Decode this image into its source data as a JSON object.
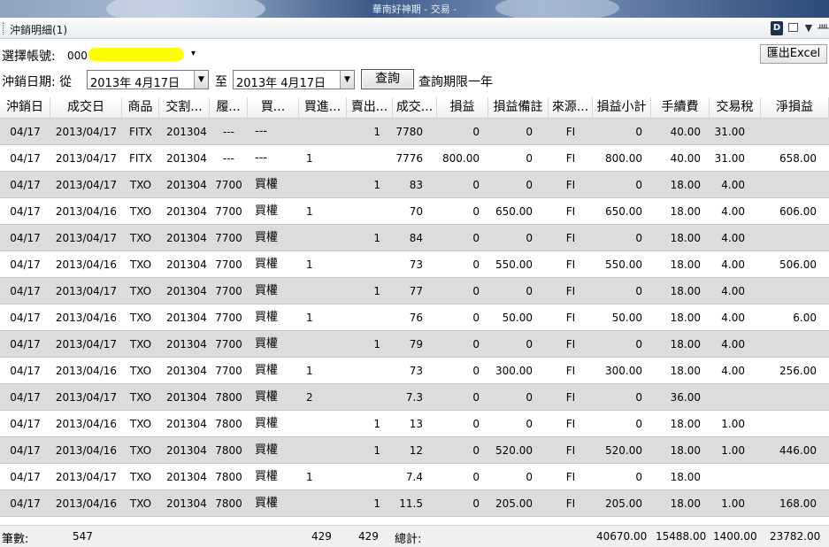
{
  "window": {
    "title": "華南好神期 - 交易 -"
  },
  "panel": {
    "title": "沖銷明細(1)",
    "d_button": "D"
  },
  "account": {
    "label": "選擇帳號:",
    "value": "000"
  },
  "export_button": "匯出Excel",
  "date_filter": {
    "label": "沖銷日期: 從",
    "from": "2013年  4月17日",
    "to_label": "至",
    "to": "2013年  4月17日",
    "query_button": "查詢",
    "note": "查詢期限一年"
  },
  "table": {
    "columns": [
      "沖銷日",
      "成交日",
      "商品",
      "交割...",
      "履...",
      "買...",
      "買進...",
      "賣出...",
      "成交...",
      "損益",
      "損益備註",
      "來源...",
      "損益小計",
      "手續費",
      "交易稅",
      "淨損益"
    ],
    "rows": [
      [
        "04/17",
        "2013/04/17",
        "FITX",
        "201304",
        "---",
        "---",
        "",
        "1",
        "7780",
        "0",
        "0",
        "FI",
        "0",
        "40.00",
        "31.00",
        ""
      ],
      [
        "04/17",
        "2013/04/17",
        "FITX",
        "201304",
        "---",
        "---",
        "1",
        "",
        "7776",
        "800.00",
        "0",
        "FI",
        "800.00",
        "40.00",
        "31.00",
        "658.00"
      ],
      [
        "04/17",
        "2013/04/17",
        "TXO",
        "201304",
        "7700",
        "買權",
        "",
        "1",
        "83",
        "0",
        "0",
        "FI",
        "0",
        "18.00",
        "4.00",
        ""
      ],
      [
        "04/17",
        "2013/04/16",
        "TXO",
        "201304",
        "7700",
        "買權",
        "1",
        "",
        "70",
        "0",
        "650.00",
        "FI",
        "650.00",
        "18.00",
        "4.00",
        "606.00"
      ],
      [
        "04/17",
        "2013/04/17",
        "TXO",
        "201304",
        "7700",
        "買權",
        "",
        "1",
        "84",
        "0",
        "0",
        "FI",
        "0",
        "18.00",
        "4.00",
        ""
      ],
      [
        "04/17",
        "2013/04/16",
        "TXO",
        "201304",
        "7700",
        "買權",
        "1",
        "",
        "73",
        "0",
        "550.00",
        "FI",
        "550.00",
        "18.00",
        "4.00",
        "506.00"
      ],
      [
        "04/17",
        "2013/04/17",
        "TXO",
        "201304",
        "7700",
        "買權",
        "",
        "1",
        "77",
        "0",
        "0",
        "FI",
        "0",
        "18.00",
        "4.00",
        ""
      ],
      [
        "04/17",
        "2013/04/16",
        "TXO",
        "201304",
        "7700",
        "買權",
        "1",
        "",
        "76",
        "0",
        "50.00",
        "FI",
        "50.00",
        "18.00",
        "4.00",
        "6.00"
      ],
      [
        "04/17",
        "2013/04/17",
        "TXO",
        "201304",
        "7700",
        "買權",
        "",
        "1",
        "79",
        "0",
        "0",
        "FI",
        "0",
        "18.00",
        "4.00",
        ""
      ],
      [
        "04/17",
        "2013/04/16",
        "TXO",
        "201304",
        "7700",
        "買權",
        "1",
        "",
        "73",
        "0",
        "300.00",
        "FI",
        "300.00",
        "18.00",
        "4.00",
        "256.00"
      ],
      [
        "04/17",
        "2013/04/17",
        "TXO",
        "201304",
        "7800",
        "買權",
        "2",
        "",
        "7.3",
        "0",
        "0",
        "FI",
        "0",
        "36.00",
        "",
        ""
      ],
      [
        "04/17",
        "2013/04/16",
        "TXO",
        "201304",
        "7800",
        "買權",
        "",
        "1",
        "13",
        "0",
        "0",
        "FI",
        "0",
        "18.00",
        "1.00",
        ""
      ],
      [
        "04/17",
        "2013/04/16",
        "TXO",
        "201304",
        "7800",
        "買權",
        "",
        "1",
        "12",
        "0",
        "520.00",
        "FI",
        "520.00",
        "18.00",
        "1.00",
        "446.00"
      ],
      [
        "04/17",
        "2013/04/17",
        "TXO",
        "201304",
        "7800",
        "買權",
        "1",
        "",
        "7.4",
        "0",
        "0",
        "FI",
        "0",
        "18.00",
        "",
        ""
      ],
      [
        "04/17",
        "2013/04/16",
        "TXO",
        "201304",
        "7800",
        "買權",
        "",
        "1",
        "11.5",
        "0",
        "205.00",
        "FI",
        "205.00",
        "18.00",
        "1.00",
        "168.00"
      ]
    ]
  },
  "footer": {
    "count_label": "筆數:",
    "count": "547",
    "buy_total": "429",
    "sell_total": "429",
    "total_label": "總計:",
    "pl_subtotal": "40670.00",
    "fee_total": "15488.00",
    "tax_total": "1400.00",
    "net_total": "23782.00"
  },
  "colors": {
    "highlight_mask": "#ffff00",
    "odd_row": "#dcdcdc",
    "even_row": "#ffffff"
  },
  "icons": [
    "dock-d-icon",
    "window-icon",
    "dropdown-arrow-icon",
    "pin-icon"
  ]
}
